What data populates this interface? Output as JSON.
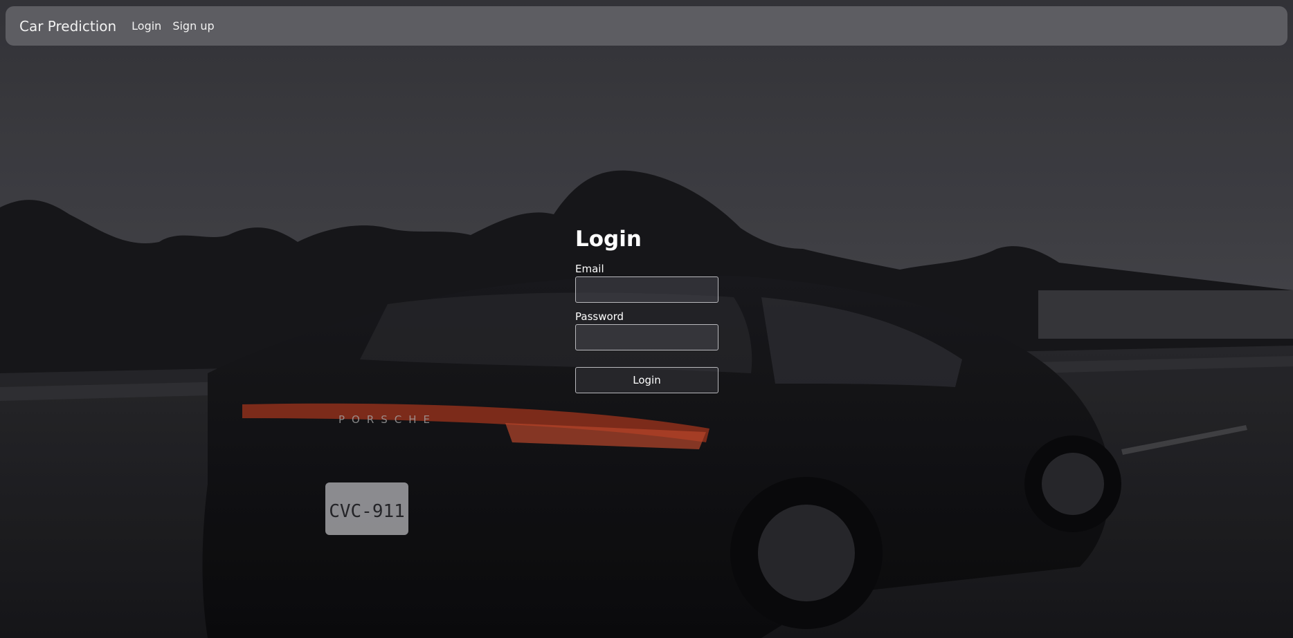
{
  "navbar": {
    "brand": "Car Prediction",
    "links": [
      {
        "label": "Login"
      },
      {
        "label": "Sign up"
      }
    ]
  },
  "login_form": {
    "title": "Login",
    "email_label": "Email",
    "email_value": "",
    "password_label": "Password",
    "password_value": "",
    "submit_label": "Login"
  },
  "background": {
    "description_icon": "car-photo",
    "license_plate": "CVC-911"
  }
}
